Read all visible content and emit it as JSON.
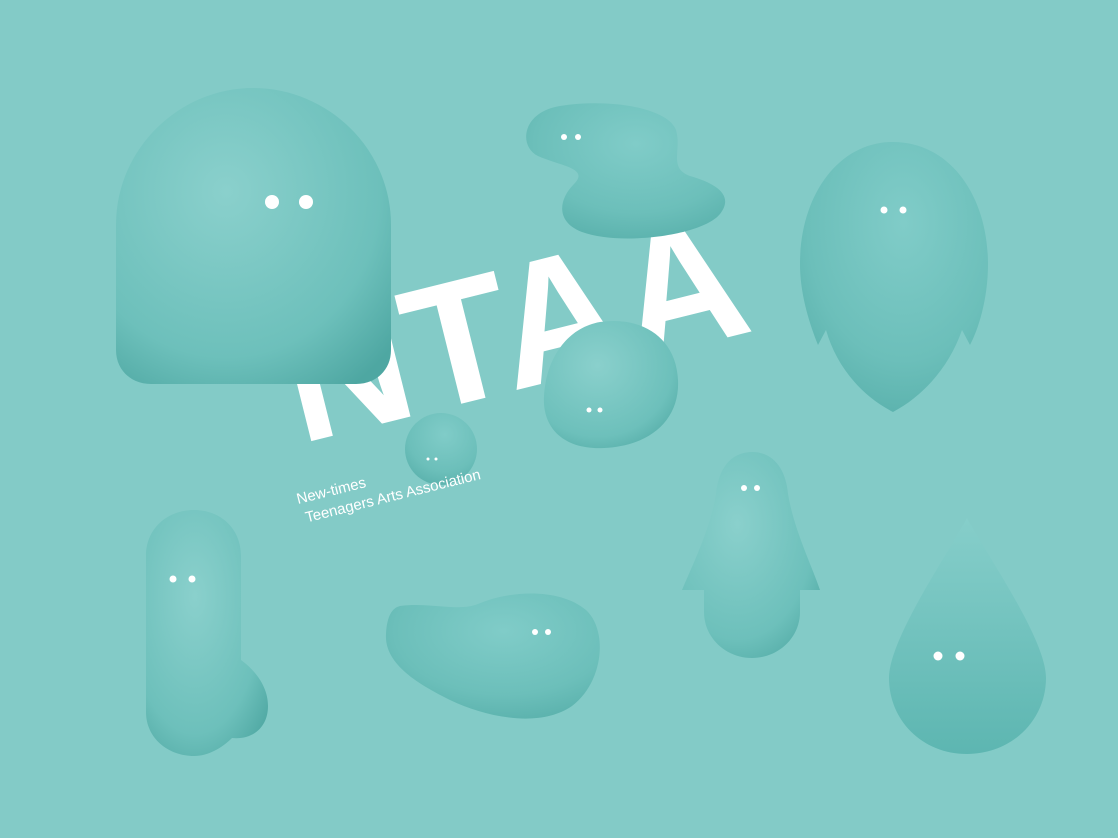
{
  "logo": {
    "wordmark": "NTAA",
    "tagline_line1": "New-times",
    "tagline_line2": "Teenagers Arts Association"
  },
  "colors": {
    "background": "#83cbc7",
    "blob_fill": "#6fc0bb",
    "blob_shadow": "#4fa9a4",
    "text": "#ffffff"
  },
  "characters": [
    {
      "name": "arch-blob"
    },
    {
      "name": "wavy-blob"
    },
    {
      "name": "egg-blob"
    },
    {
      "name": "small-lump-blob"
    },
    {
      "name": "bubble-blob"
    },
    {
      "name": "boot-blob"
    },
    {
      "name": "puddle-blob"
    },
    {
      "name": "ghost-blob"
    },
    {
      "name": "drop-blob"
    }
  ]
}
